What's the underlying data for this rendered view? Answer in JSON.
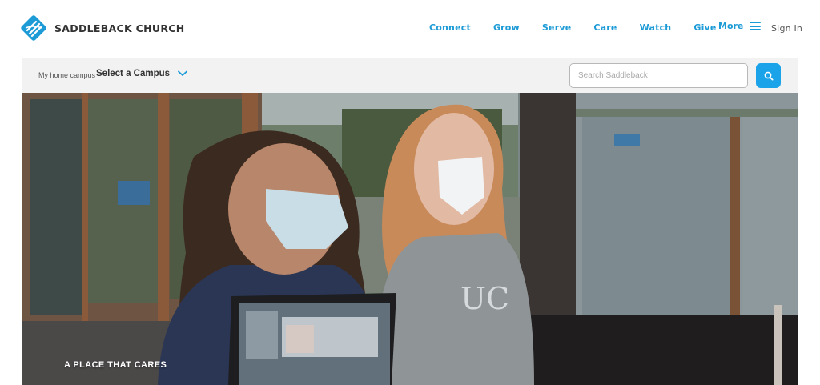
{
  "header": {
    "brand_name": "SADDLEBACK CHURCH",
    "brand_color": "#1d9bd7",
    "logo_icon": "saddleback-logo-icon",
    "nav": [
      {
        "label": "Connect"
      },
      {
        "label": "Grow"
      },
      {
        "label": "Serve"
      },
      {
        "label": "Care"
      },
      {
        "label": "Watch"
      },
      {
        "label": "Give"
      }
    ],
    "more_label": "More",
    "more_icon": "hamburger-menu-icon",
    "sign_in_label": "Sign In"
  },
  "campus_bar": {
    "label": "My home campus",
    "selected_campus": "Select a Campus",
    "dropdown_icon": "chevron-down-icon",
    "search_placeholder": "Search Saddleback",
    "search_icon": "search-icon",
    "accent_color": "#1aa3e8"
  },
  "hero": {
    "caption": "A PLACE THAT CARES",
    "shirt_text": "UC"
  }
}
